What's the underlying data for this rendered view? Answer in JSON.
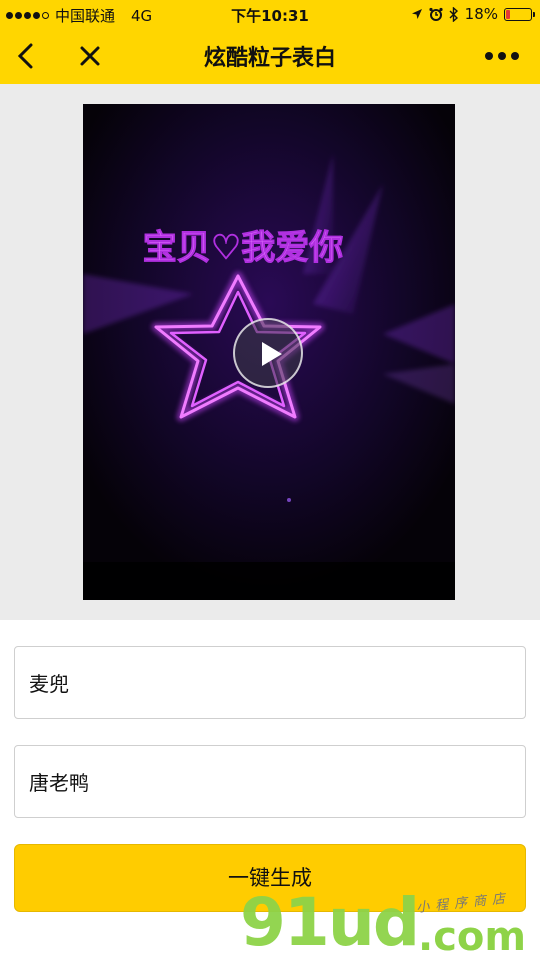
{
  "status_bar": {
    "carrier": "中国联通",
    "network": "4G",
    "time": "下午10:31",
    "battery_percent": "18%",
    "battery_level": 0.18
  },
  "nav": {
    "title": "炫酷粒子表白",
    "back_icon": "chevron-left-icon",
    "close_icon": "close-icon",
    "more_icon": "more-dots-icon"
  },
  "video": {
    "overlay_text": "宝贝♡我爱你"
  },
  "form": {
    "name1_value": "麦兜",
    "name2_value": "唐老鸭",
    "generate_label": "一键生成"
  },
  "watermark": {
    "main": "91ud",
    "domain": ".com",
    "subtitle": "小程序商店"
  },
  "colors": {
    "brand_yellow": "#ffd600",
    "button_yellow": "#ffcc00",
    "laser_pink": "#d85cf5",
    "watermark_green": "#8ed348"
  }
}
